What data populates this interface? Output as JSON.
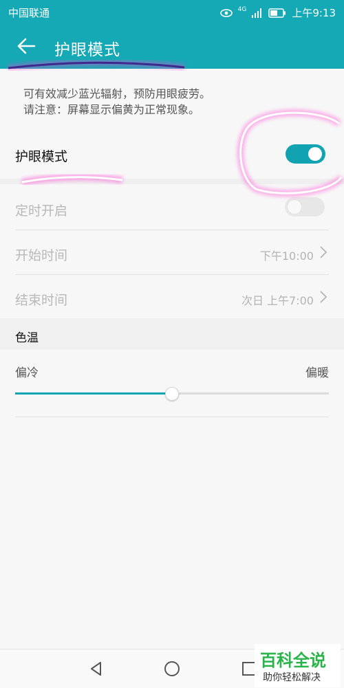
{
  "status": {
    "carrier": "中国联通",
    "time": "上午9:13",
    "network": "4G"
  },
  "header": {
    "title": "护眼模式",
    "back_icon": "arrow-left-icon"
  },
  "description": {
    "line1": "可有效减少蓝光辐射，预防用眼疲劳。",
    "line2": "请注意：屏幕显示偏黄为正常现象。"
  },
  "eye_mode": {
    "label": "护眼模式",
    "enabled": true
  },
  "schedule": {
    "label": "定时开启",
    "enabled": false,
    "start": {
      "label": "开始时间",
      "value": "下午10:00"
    },
    "end": {
      "label": "结束时间",
      "value": "次日 上午7:00"
    }
  },
  "color_temp": {
    "header": "色温",
    "left_label": "偏冷",
    "right_label": "偏暖",
    "level": 0.5
  },
  "watermark": {
    "title": "百科全说",
    "subtitle": "助你轻松解决"
  },
  "colors": {
    "accent": "#15a8b5",
    "annotation": "#ff3fd0"
  }
}
